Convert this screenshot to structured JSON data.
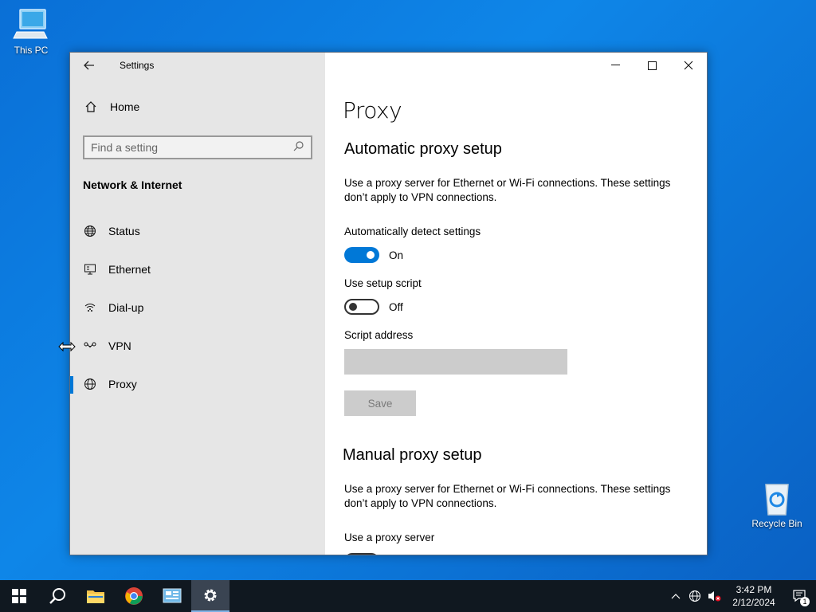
{
  "desktop": {
    "this_pc": "This PC",
    "recycle_bin": "Recycle Bin"
  },
  "window": {
    "title": "Settings",
    "controls": {
      "minimize": "—",
      "maximize": "☐",
      "close": "✕"
    }
  },
  "sidebar": {
    "home": "Home",
    "search_placeholder": "Find a setting",
    "section": "Network & Internet",
    "items": [
      {
        "label": "Status",
        "icon": "globe-icon"
      },
      {
        "label": "Ethernet",
        "icon": "ethernet-icon"
      },
      {
        "label": "Dial-up",
        "icon": "dialup-icon"
      },
      {
        "label": "VPN",
        "icon": "vpn-icon"
      },
      {
        "label": "Proxy",
        "icon": "globe-icon",
        "active": true
      }
    ]
  },
  "content": {
    "title": "Proxy",
    "auto_heading": "Automatic proxy setup",
    "auto_desc": "Use a proxy server for Ethernet or Wi-Fi connections. These settings don’t apply to VPN connections.",
    "auto_detect_label": "Automatically detect settings",
    "auto_detect_state": "On",
    "setup_script_label": "Use setup script",
    "setup_script_state": "Off",
    "script_address_label": "Script address",
    "script_address_value": "",
    "save_label": "Save",
    "manual_heading": "Manual proxy setup",
    "manual_desc": "Use a proxy server for Ethernet or Wi-Fi connections. These settings don’t apply to VPN connections.",
    "use_proxy_label": "Use a proxy server"
  },
  "taskbar": {
    "time": "3:42 PM",
    "date": "2/12/2024",
    "notification_count": "1"
  },
  "colors": {
    "accent": "#0078d7",
    "sidebar_bg": "#e6e6e6",
    "taskbar_bg": "#101820"
  }
}
